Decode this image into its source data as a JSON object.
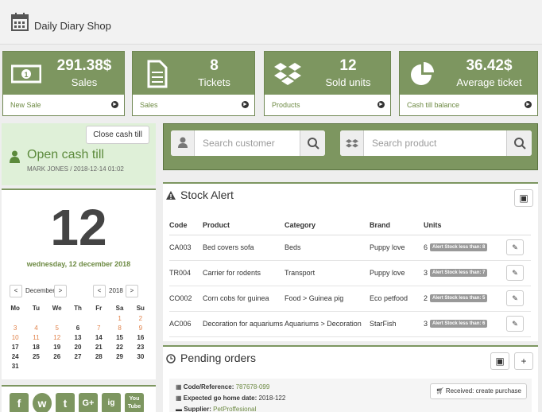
{
  "app": {
    "title": "Daily Diary Shop"
  },
  "stats": [
    {
      "value": "291.38$",
      "label": "Sales",
      "link": "New Sale",
      "icon": "cash-icon"
    },
    {
      "value": "8",
      "label": "Tickets",
      "link": "Sales",
      "icon": "document-icon"
    },
    {
      "value": "12",
      "label": "Sold units",
      "link": "Products",
      "icon": "dropbox-icon"
    },
    {
      "value": "36.42$",
      "label": "Average ticket",
      "link": "Cash till balance",
      "icon": "pie-chart-icon"
    }
  ],
  "cash": {
    "close_label": "Close cash till",
    "title": "Open cash till",
    "subtitle": "MARK JONES / 2018-12-14 01:02"
  },
  "calendar": {
    "day": "12",
    "date_line": "wednesday, 12 december 2018",
    "month": "December",
    "year": "2018",
    "weekdays": [
      "Mo",
      "Tu",
      "We",
      "Th",
      "Fr",
      "Sa",
      "Su"
    ],
    "weeks": [
      [
        "",
        "",
        "",
        "",
        "",
        "1",
        "2"
      ],
      [
        "3",
        "4",
        "5",
        "6",
        "7",
        "8",
        "9"
      ],
      [
        "10",
        "11",
        "12",
        "13",
        "14",
        "15",
        "16"
      ],
      [
        "17",
        "18",
        "19",
        "20",
        "21",
        "22",
        "23"
      ],
      [
        "24",
        "25",
        "26",
        "27",
        "28",
        "29",
        "30"
      ],
      [
        "31",
        "",
        "",
        "",
        "",
        "",
        ""
      ]
    ]
  },
  "social": [
    "f",
    "w",
    "t",
    "G+",
    "ig",
    "You Tube"
  ],
  "search": {
    "customer_placeholder": "Search customer",
    "product_placeholder": "Search product"
  },
  "stock_alert": {
    "title": "Stock Alert",
    "columns": [
      "Code",
      "Product",
      "Category",
      "Brand",
      "Units"
    ],
    "rows": [
      {
        "code": "CA003",
        "product": "Bed covers sofa",
        "category": "Beds",
        "brand": "Puppy love",
        "units": "6",
        "badge": "Alert Stock less than: 8"
      },
      {
        "code": "TR004",
        "product": "Carrier for rodents",
        "category": "Transport",
        "brand": "Puppy love",
        "units": "3",
        "badge": "Alert Stock less than: 7"
      },
      {
        "code": "CO002",
        "product": "Corn cobs for guinea",
        "category": "Food > Guinea pig",
        "brand": "Eco petfood",
        "units": "2",
        "badge": "Alert Stock less than: 5"
      },
      {
        "code": "AC006",
        "product": "Decoration for aquariums",
        "category": "Aquariums > Decoration",
        "brand": "StarFish",
        "units": "3",
        "badge": "Alert Stock less than: 6"
      }
    ]
  },
  "pending": {
    "title": "Pending orders",
    "code_label": "Code/Reference:",
    "code_value": "787678-099",
    "date_label": "Expected go home date:",
    "date_value": "2018-122",
    "supplier_label": "Supplier:",
    "supplier_value": "PetProffesional",
    "received_label": "Received: create purchase"
  },
  "colors": {
    "accent": "#7d9660",
    "accent_dark": "#5b7340",
    "link": "#6d8a43",
    "weekend": "#e0824a",
    "cash_bg": "#dff0d8"
  }
}
